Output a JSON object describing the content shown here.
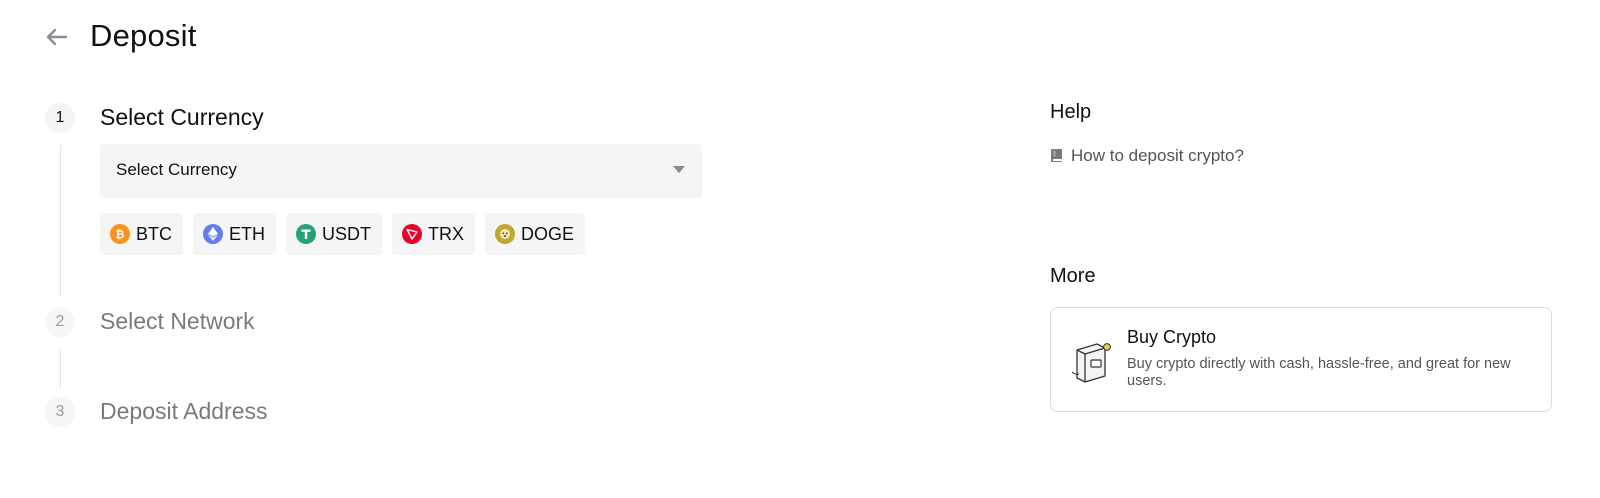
{
  "header": {
    "title": "Deposit"
  },
  "steps": [
    {
      "number": "1",
      "title": "Select Currency"
    },
    {
      "number": "2",
      "title": "Select Network"
    },
    {
      "number": "3",
      "title": "Deposit Address"
    }
  ],
  "currency_select": {
    "placeholder": "Select Currency"
  },
  "quick_currencies": [
    {
      "symbol": "BTC",
      "icon": "bitcoin-icon",
      "color": "#F7931A"
    },
    {
      "symbol": "ETH",
      "icon": "ethereum-icon",
      "color": "#627EEA"
    },
    {
      "symbol": "USDT",
      "icon": "tether-icon",
      "color": "#26A17B"
    },
    {
      "symbol": "TRX",
      "icon": "tron-icon",
      "color": "#EB0029"
    },
    {
      "symbol": "DOGE",
      "icon": "dogecoin-icon",
      "color": "#C2A633"
    }
  ],
  "help": {
    "title": "Help",
    "link_label": "How to deposit crypto?"
  },
  "more": {
    "title": "More",
    "card": {
      "title": "Buy Crypto",
      "description": "Buy crypto directly with cash, hassle-free, and great for new users."
    }
  }
}
